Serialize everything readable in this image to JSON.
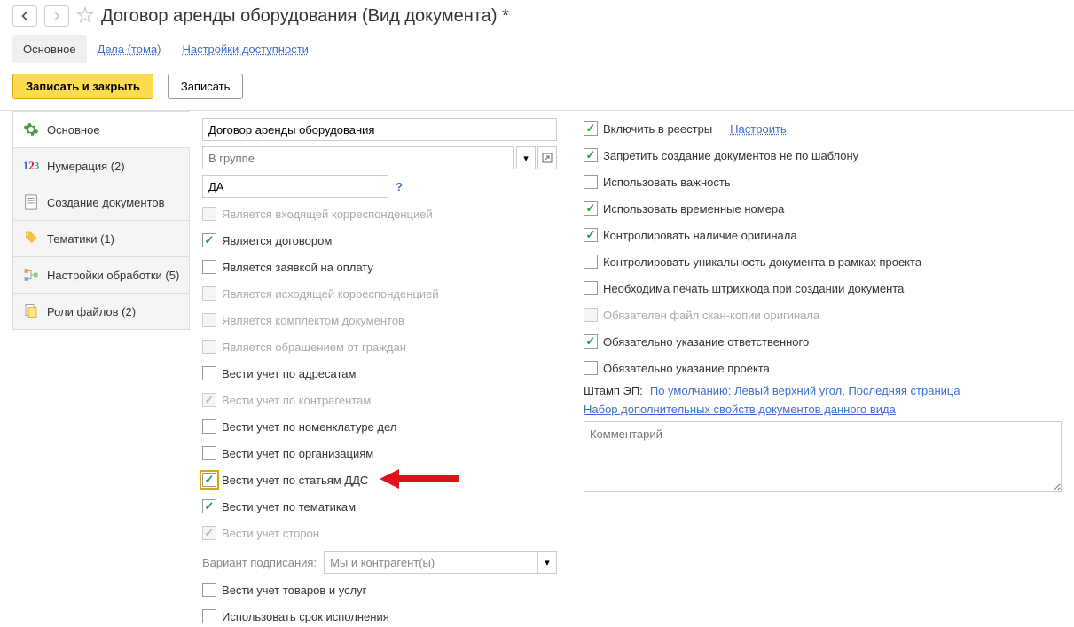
{
  "header": {
    "title": "Договор аренды оборудования (Вид документа) *"
  },
  "topTabs": {
    "main": "Основное",
    "cases": "Дела (тома)",
    "access": "Настройки доступности"
  },
  "actions": {
    "saveClose": "Записать и закрыть",
    "save": "Записать"
  },
  "sideTabs": {
    "main": "Основное",
    "numbering": "Нумерация (2)",
    "creation": "Создание документов",
    "topics": "Тематики (1)",
    "processing": "Настройки обработки (5)",
    "fileRoles": "Роли файлов (2)"
  },
  "form": {
    "name": "Договор аренды оборудования",
    "groupPlaceholder": "В группе",
    "code": "ДА",
    "left": {
      "incoming": "Является входящей корреспонденцией",
      "contract": "Является договором",
      "payRequest": "Является заявкой на оплату",
      "outgoing": "Является исходящей корреспонденцией",
      "docSet": "Является комплектом документов",
      "citizenAppeal": "Является обращением от граждан",
      "addressees": "Вести учет по адресатам",
      "counterparties": "Вести учет по контрагентам",
      "caseNomenclature": "Вести учет по номенклатуре дел",
      "organizations": "Вести учет по организациям",
      "ddsArticles": "Вести учет по статьям ДДС",
      "byTopics": "Вести учет по тематикам",
      "parties": "Вести учет сторон",
      "signVariantLabel": "Вариант подписания:",
      "signVariant": "Мы и контрагент(ы)",
      "goodsServices": "Вести учет товаров и услуг",
      "dueDate": "Использовать срок исполнения"
    },
    "right": {
      "includeRegistries": "Включить в реестры",
      "configure": "Настроить",
      "forbidNonTemplate": "Запретить создание документов не по шаблону",
      "useImportance": "Использовать важность",
      "useTempNumbers": "Использовать временные номера",
      "controlOriginal": "Контролировать наличие оригинала",
      "controlUnique": "Контролировать уникальность документа в рамках проекта",
      "needBarcode": "Необходима печать штрихкода при создании документа",
      "requireScanCopy": "Обязателен файл скан-копии оригинала",
      "requireResponsible": "Обязательно указание ответственного",
      "requireProject": "Обязательно указание проекта",
      "stampLabel": "Штамп ЭП:",
      "stampValue": "По умолчанию: Левый верхний угол, Последняя страница",
      "additionalProps": "Набор дополнительных свойств документов данного вида",
      "commentPlaceholder": "Комментарий"
    }
  }
}
